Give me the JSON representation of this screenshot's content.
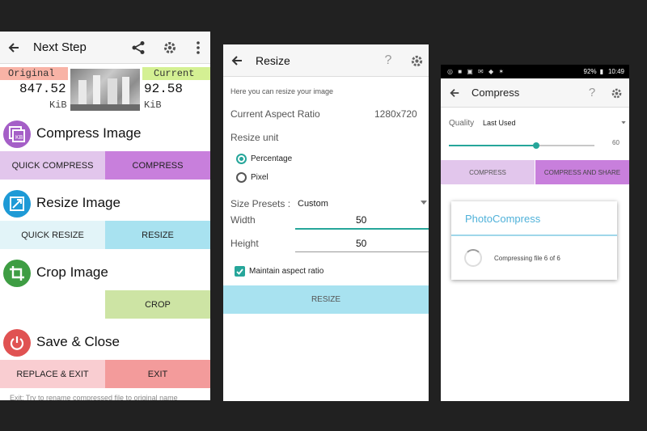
{
  "colors": {
    "teal": "#26a69a",
    "purple": "#c87fdc",
    "lavender": "#e2c6ec",
    "blue": "#a8e2f0",
    "lightblue": "#e2f4f8",
    "green": "#cde4a4",
    "red": "#f39b9b",
    "pink": "#f9cdd1"
  },
  "screen1": {
    "title": "Next Step",
    "original_label": "Original",
    "original_size": "847.52",
    "original_unit": "KiB",
    "current_label": "Current",
    "current_size": "92.58",
    "current_unit": "KiB",
    "compress": {
      "title": "Compress Image",
      "quick": "QUICK COMPRESS",
      "action": "COMPRESS"
    },
    "resize": {
      "title": "Resize Image",
      "quick": "QUICK RESIZE",
      "action": "RESIZE"
    },
    "crop": {
      "title": "Crop Image",
      "action": "CROP"
    },
    "save": {
      "title": "Save & Close",
      "replace": "REPLACE & EXIT",
      "exit": "EXIT"
    },
    "footer_note": "Exit: Try to rename compressed file to original name"
  },
  "screen2": {
    "title": "Resize",
    "hint": "Here you can resize your image",
    "aspect_label": "Current Aspect Ratio",
    "aspect_value": "1280x720",
    "unit_label": "Resize unit",
    "unit_options": [
      "Percentage",
      "Pixel"
    ],
    "selected_unit": "Percentage",
    "presets_label": "Size Presets :",
    "presets_value": "Custom",
    "width_label": "Width",
    "width_value": "50",
    "height_label": "Height",
    "height_value": "50",
    "maintain_label": "Maintain aspect ratio",
    "maintain_checked": true,
    "resize_button": "RESIZE"
  },
  "screen3": {
    "status_battery": "92%",
    "status_time": "10:49",
    "title": "Compress",
    "quality_label": "Quality",
    "quality_mode": "Last Used",
    "quality_value": "60",
    "compress_button": "COMPRESS",
    "compress_share_button": "COMPRESS AND SHARE",
    "dialog_title": "PhotoCompress",
    "dialog_message": "Compressing file 6 of 6"
  }
}
